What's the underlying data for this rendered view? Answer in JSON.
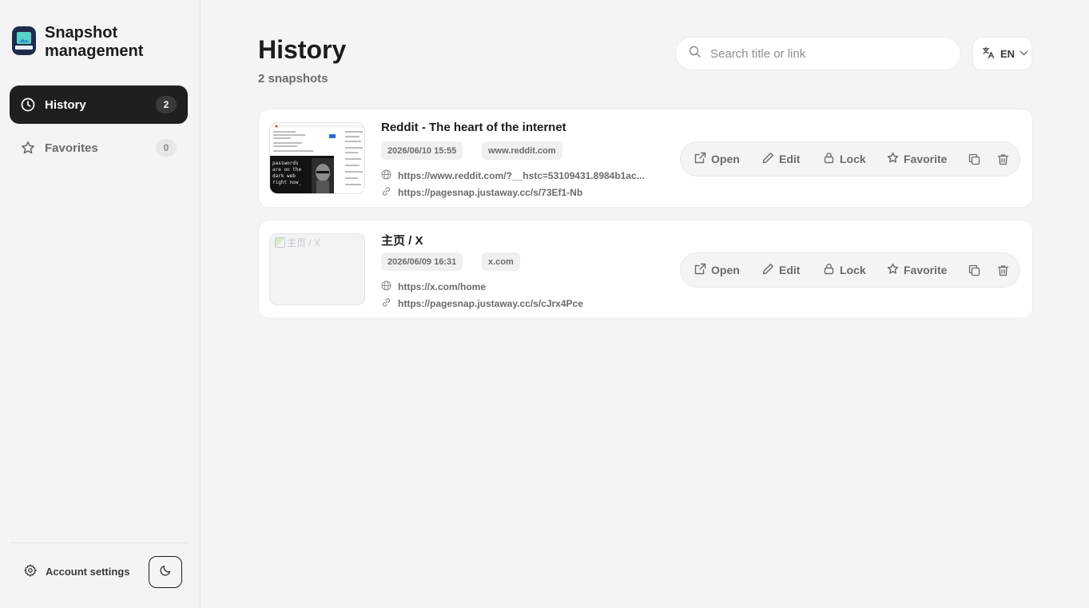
{
  "app": {
    "title": "Snapshot management"
  },
  "sidebar": {
    "items": [
      {
        "label": "History",
        "count": "2",
        "icon": "clock-icon",
        "active": true
      },
      {
        "label": "Favorites",
        "count": "0",
        "icon": "star-icon",
        "active": false
      }
    ],
    "account_label": "Account settings",
    "theme_icon": "moon-icon"
  },
  "header": {
    "title": "History",
    "subtitle": "2 snapshots",
    "search_placeholder": "Search title or link",
    "search_value": "",
    "language": "EN"
  },
  "snapshots": [
    {
      "title": "Reddit - The heart of the internet",
      "date": "2026/06/10 15:55",
      "domain": "www.reddit.com",
      "source_url": "https://www.reddit.com/?__hstc=53109431.8984b1ac...",
      "share_url": "https://pagesnap.justaway.cc/s/73Ef1-Nb",
      "thumbnail_text": "passwords are on the dark web right now",
      "thumbnail_alt": ""
    },
    {
      "title": "主页 / X",
      "date": "2026/06/09 16:31",
      "domain": "x.com",
      "source_url": "https://x.com/home",
      "share_url": "https://pagesnap.justaway.cc/s/cJrx4Pce",
      "thumbnail_text": "",
      "thumbnail_alt": "主页 / X"
    }
  ],
  "actions": {
    "open": "Open",
    "edit": "Edit",
    "lock": "Lock",
    "favorite": "Favorite"
  },
  "colors": {
    "sidebar_active_bg": "#1f1f22",
    "background": "#f4f4f6",
    "card_bg": "#ffffff",
    "muted_text": "#6b6b70"
  }
}
